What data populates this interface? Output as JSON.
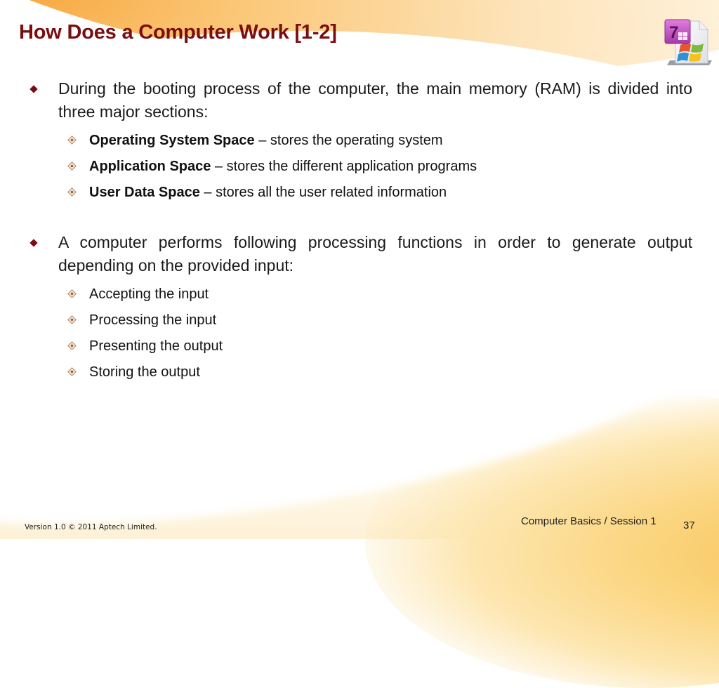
{
  "slide": {
    "title": "How Does a Computer Work [1-2]",
    "logo_icon": "windows-7-document-icon",
    "bullets": [
      {
        "text": "During the booting process of the computer, the main memory (RAM) is divided into three major sections:",
        "sub": [
          {
            "bold": "Operating System Space",
            "text": " – stores the operating system"
          },
          {
            "bold": "Application Space",
            "text": " – stores the different application programs"
          },
          {
            "bold": "User Data Space",
            "text": " – stores all the user related information"
          }
        ]
      },
      {
        "text": "A computer performs following processing functions in order to generate output depending on the provided input:",
        "sub": [
          {
            "bold": "",
            "text": "Accepting the input"
          },
          {
            "bold": "",
            "text": "Processing the input"
          },
          {
            "bold": "",
            "text": "Presenting the output"
          },
          {
            "bold": "",
            "text": "Storing the output"
          }
        ]
      }
    ]
  },
  "footer": {
    "copyright": "Version 1.0 © 2011 Aptech Limited.",
    "course": "Computer Basics / Session 1",
    "page_number": "37"
  },
  "colors": {
    "title": "#7b0d10",
    "bullet": "#7b0d10",
    "accent_orange": "#f7a53c",
    "accent_yellow": "#f8c156"
  }
}
